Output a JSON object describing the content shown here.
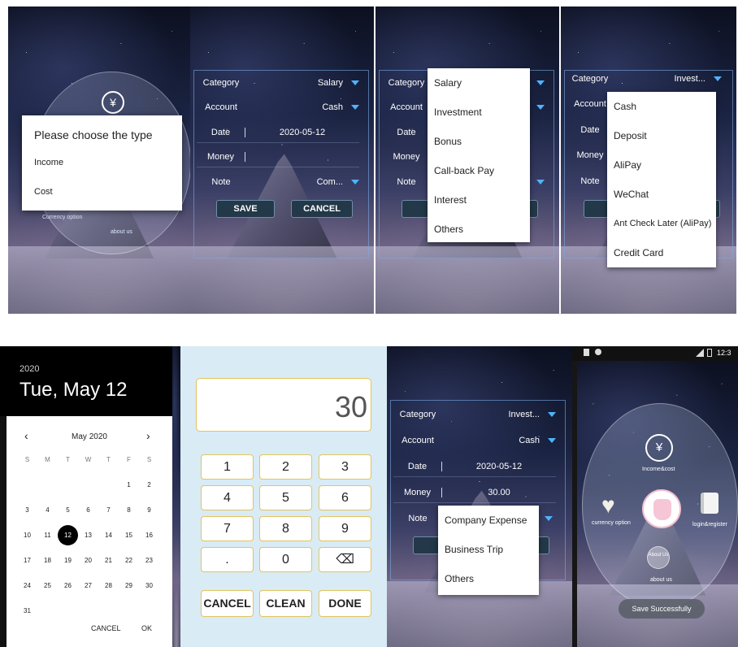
{
  "screen1": {
    "dialog_title": "Please choose the type",
    "options": [
      "Income",
      "Cost"
    ],
    "bg_labels": [
      "Currency option",
      "about us"
    ]
  },
  "screen2": {
    "rows": [
      {
        "label": "Category",
        "value": "Salary"
      },
      {
        "label": "Account",
        "value": "Cash"
      },
      {
        "label": "Date",
        "value": "2020-05-12"
      },
      {
        "label": "Money",
        "value": ""
      },
      {
        "label": "Note",
        "value": "Com..."
      }
    ],
    "save": "SAVE",
    "cancel": "CANCEL"
  },
  "screen3": {
    "labels": [
      "Category",
      "Account",
      "Date",
      "Money",
      "Note"
    ],
    "menu": [
      "Salary",
      "Investment",
      "Bonus",
      "Call-back Pay",
      "Interest",
      "Others"
    ]
  },
  "screen4": {
    "labels": [
      "Category",
      "Account",
      "Date",
      "Money",
      "Note"
    ],
    "category_value": "Invest...",
    "menu": [
      "Cash",
      "Deposit",
      "AliPay",
      "WeChat",
      "Ant Check Later (AliPay)",
      "Credit Card"
    ]
  },
  "datepicker": {
    "year": "2020",
    "date_title": "Tue, May 12",
    "month": "May 2020",
    "weekdays": [
      "S",
      "M",
      "T",
      "W",
      "T",
      "F",
      "S"
    ],
    "days": [
      "",
      "",
      "",
      "",
      "",
      "1",
      "2",
      "3",
      "4",
      "5",
      "6",
      "7",
      "8",
      "9",
      "10",
      "11",
      "12",
      "13",
      "14",
      "15",
      "16",
      "17",
      "18",
      "19",
      "20",
      "21",
      "22",
      "23",
      "24",
      "25",
      "26",
      "27",
      "28",
      "29",
      "30",
      "31"
    ],
    "selected_day": "12",
    "cancel": "CANCEL",
    "ok": "OK"
  },
  "numpad": {
    "display": "30",
    "keys": [
      "1",
      "2",
      "3",
      "4",
      "5",
      "6",
      "7",
      "8",
      "9",
      ".",
      "0",
      "⌫"
    ],
    "cancel": "CANCEL",
    "clean": "CLEAN",
    "done": "DONE"
  },
  "screen7": {
    "rows": [
      {
        "label": "Category",
        "value": "Invest..."
      },
      {
        "label": "Account",
        "value": "Cash"
      },
      {
        "label": "Date",
        "value": "2020-05-12"
      },
      {
        "label": "Money",
        "value": "30.00"
      },
      {
        "label": "Note",
        "value": ""
      }
    ],
    "menu": [
      "Company Expense",
      "Business Trip",
      "Others"
    ],
    "save_partial": "S"
  },
  "home": {
    "time": "12:3",
    "income_cost": "Income&cost",
    "currency_option": "currency option",
    "login_register": "login&register",
    "about_us_bubble": "About Us",
    "about_us": "about us",
    "toast": "Save Successfully"
  },
  "colors": {
    "accent_blue": "#4fb3ff",
    "numpad_bg": "#d9ebf4",
    "key_border": "#e2c45e",
    "button_dark": "#233848"
  }
}
